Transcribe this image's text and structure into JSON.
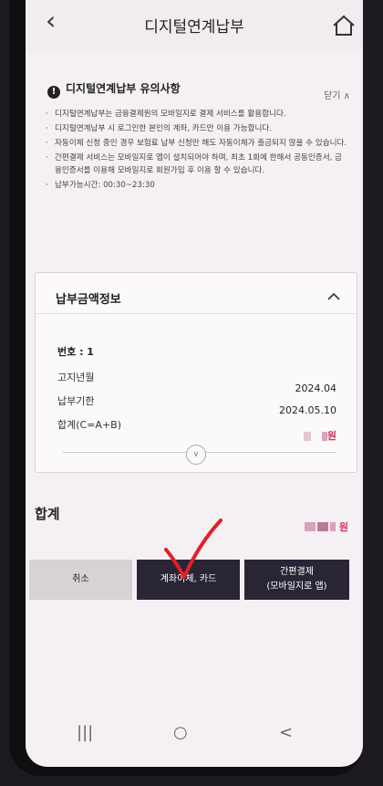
{
  "header": {
    "title": "디지털연계납부"
  },
  "notice": {
    "heading": "디지털연계납부 유의사항",
    "close_label": "닫기 ∧",
    "items": [
      "디지털연계납부는 금융결제원의 모바일지로 결제 서비스를 활용합니다.",
      "디지털연계납부 시 로그인한 본인의 계좌, 카드만 이용 가능합니다.",
      "자동이체 신청 중인 경우 보험료 납부 신청만 해도 자동이체가 출금되지 않을 수 있습니다.",
      "간편결제 서비스는 모바일지로 앱이 설치되어야 하며, 최초 1회에 한해서 공동인증서, 금융인증서를 이용해 모바일지로 회원가입 후 이용 할 수 있습니다.",
      "납부가능시간: 00:30~23:30"
    ]
  },
  "amount_card": {
    "title": "납부금액정보",
    "number_label": "번호 : 1",
    "rows": [
      {
        "label": "고지년월",
        "value": "2024.04"
      },
      {
        "label": "납부기한",
        "value": "2024.05.10"
      },
      {
        "label": "합계(C=A+B)",
        "value": "원"
      }
    ]
  },
  "total": {
    "label": "합계",
    "value": "원"
  },
  "buttons": {
    "cancel": "취소",
    "account_card": "계좌이체, 카드",
    "simple_pay_line1": "간편결제",
    "simple_pay_line2": "(모바일지로 앱)"
  },
  "nav": {
    "recent": "|||",
    "home": "○",
    "back": "<"
  },
  "colors": {
    "accent": "#2a2535",
    "won": "#d0305a",
    "check": "#e0202a"
  }
}
